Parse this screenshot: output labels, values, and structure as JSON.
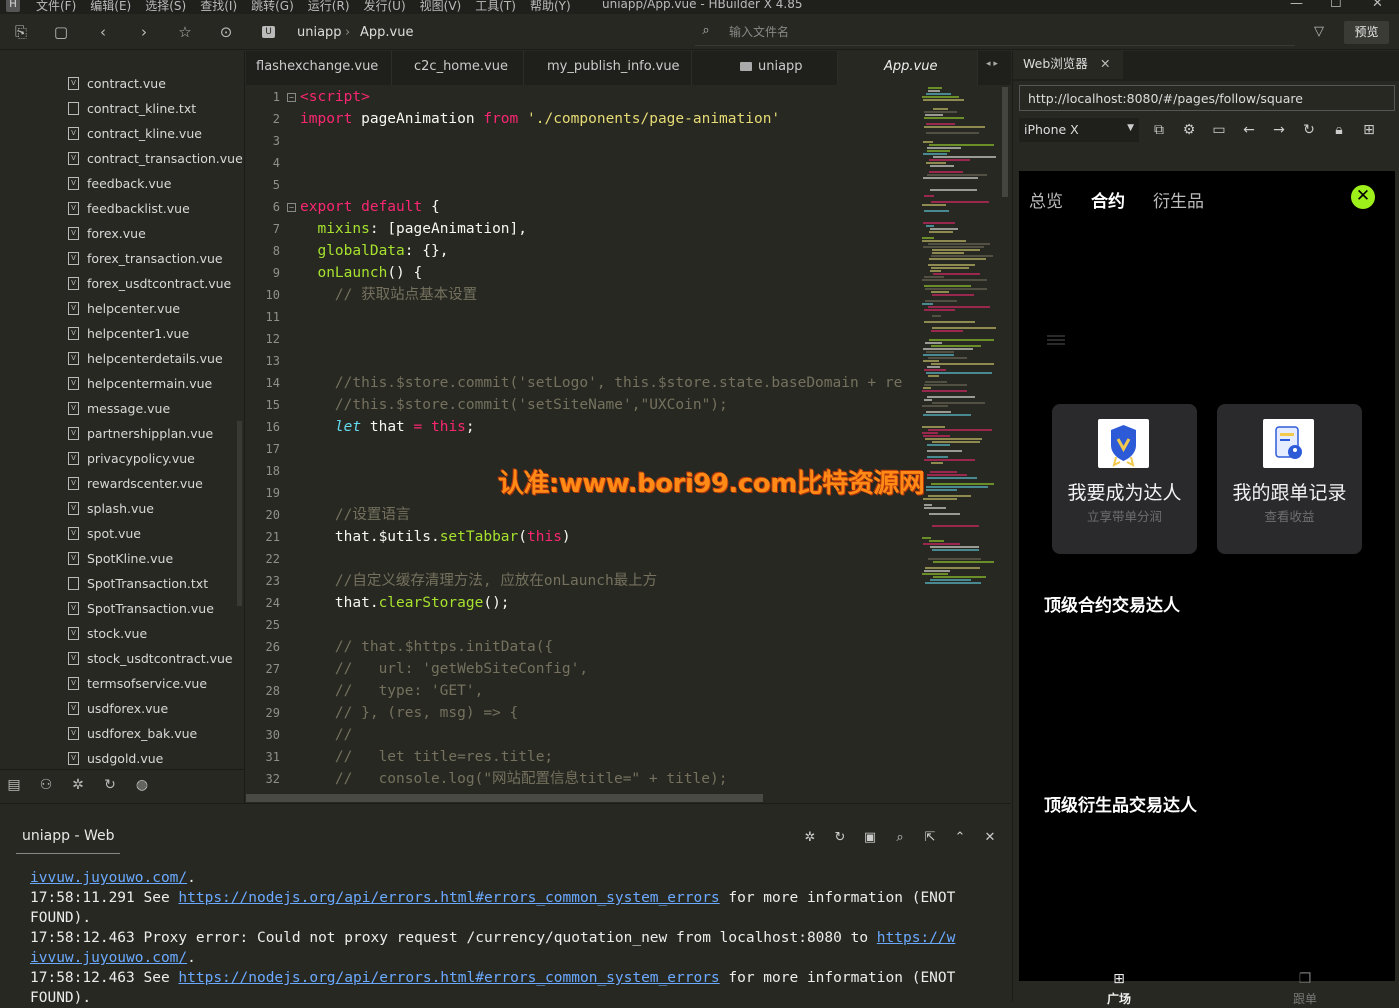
{
  "app": {
    "title": "uniapp/App.vue - HBuilder X 4.85",
    "logo": "H",
    "menus": [
      "文件(F)",
      "编辑(E)",
      "选择(S)",
      "查找(I)",
      "跳转(G)",
      "运行(R)",
      "发行(U)",
      "视图(V)",
      "工具(T)",
      "帮助(Y)"
    ],
    "window_controls": [
      "—",
      "☐",
      "✕"
    ]
  },
  "toolbar": {
    "breadcrumb": [
      "uniapp",
      "App.vue"
    ],
    "breadcrumb_sep": "›",
    "search_placeholder": "输入文件名",
    "preview_label": "预览",
    "icons": [
      "save-all-icon",
      "save-icon",
      "back-icon",
      "forward-icon",
      "star-icon",
      "run-icon",
      "filter-icon"
    ]
  },
  "sidebar": {
    "files": [
      {
        "name": "contract.vue",
        "type": "vue"
      },
      {
        "name": "contract_kline.txt",
        "type": "txt"
      },
      {
        "name": "contract_kline.vue",
        "type": "vue"
      },
      {
        "name": "contract_transaction.vue",
        "type": "vue"
      },
      {
        "name": "feedback.vue",
        "type": "vue"
      },
      {
        "name": "feedbacklist.vue",
        "type": "vue"
      },
      {
        "name": "forex.vue",
        "type": "vue"
      },
      {
        "name": "forex_transaction.vue",
        "type": "vue"
      },
      {
        "name": "forex_usdtcontract.vue",
        "type": "vue"
      },
      {
        "name": "helpcenter.vue",
        "type": "vue"
      },
      {
        "name": "helpcenter1.vue",
        "type": "vue"
      },
      {
        "name": "helpcenterdetails.vue",
        "type": "vue"
      },
      {
        "name": "helpcentermain.vue",
        "type": "vue"
      },
      {
        "name": "message.vue",
        "type": "vue"
      },
      {
        "name": "partnershipplan.vue",
        "type": "vue"
      },
      {
        "name": "privacypolicy.vue",
        "type": "vue"
      },
      {
        "name": "rewardscenter.vue",
        "type": "vue"
      },
      {
        "name": "splash.vue",
        "type": "vue"
      },
      {
        "name": "spot.vue",
        "type": "vue"
      },
      {
        "name": "SpotKline.vue",
        "type": "vue"
      },
      {
        "name": "SpotTransaction.txt",
        "type": "txt"
      },
      {
        "name": "SpotTransaction.vue",
        "type": "vue"
      },
      {
        "name": "stock.vue",
        "type": "vue"
      },
      {
        "name": "stock_usdtcontract.vue",
        "type": "vue"
      },
      {
        "name": "termsofservice.vue",
        "type": "vue"
      },
      {
        "name": "usdforex.vue",
        "type": "vue"
      },
      {
        "name": "usdforex_bak.vue",
        "type": "vue"
      },
      {
        "name": "usdgold.vue",
        "type": "vue"
      }
    ],
    "bottom_tabs": [
      "project-explorer-icon",
      "plugin-icon",
      "debug-icon",
      "git-icon",
      "web-icon"
    ]
  },
  "tabs": [
    {
      "label": "flashexchange.vue",
      "active": false
    },
    {
      "label": "c2c_home.vue",
      "active": false
    },
    {
      "label": "my_publish_info.vue",
      "active": false
    },
    {
      "label": "uniapp",
      "active": false,
      "folder": true
    },
    {
      "label": "App.vue",
      "active": true
    }
  ],
  "tab_scroll": "◂ ▸",
  "editor": {
    "lines": [
      {
        "n": "1",
        "fold": true,
        "html": "<span class='tag'>&lt;script&gt;</span>"
      },
      {
        "n": "2",
        "html": "<span class='kw'>import</span> pageAnimation <span class='kw'>from</span> <span class='str'>'./components/page-animation'</span>"
      },
      {
        "n": "3",
        "html": ""
      },
      {
        "n": "4",
        "html": ""
      },
      {
        "n": "5",
        "html": ""
      },
      {
        "n": "6",
        "fold": true,
        "html": "<span class='kw'>export default</span> {"
      },
      {
        "n": "7",
        "html": "  <span class='fn'>mixins</span>: [pageAnimation],"
      },
      {
        "n": "8",
        "html": "  <span class='fn'>globalData</span>: {},"
      },
      {
        "n": "9",
        "html": "  <span class='fn'>onLaunch</span>() {"
      },
      {
        "n": "10",
        "html": "    <span class='cm'>// 获取站点基本设置</span>"
      },
      {
        "n": "11",
        "html": ""
      },
      {
        "n": "12",
        "html": ""
      },
      {
        "n": "13",
        "html": ""
      },
      {
        "n": "14",
        "html": "    <span class='cm'>//this.$store.commit('setLogo', this.$store.state.baseDomain + re</span>"
      },
      {
        "n": "15",
        "html": "    <span class='cm'>//this.$store.commit('setSiteName',\"UXCoin\");</span>"
      },
      {
        "n": "16",
        "html": "    <span class='it'>let</span> that <span class='kw'>=</span> <span class='kw'>this</span>;"
      },
      {
        "n": "17",
        "html": ""
      },
      {
        "n": "18",
        "html": ""
      },
      {
        "n": "19",
        "html": ""
      },
      {
        "n": "20",
        "html": "    <span class='cm'>//设置语言</span>"
      },
      {
        "n": "21",
        "html": "    that.$utils.<span class='fn'>setTabbar</span>(<span class='kw'>this</span>)"
      },
      {
        "n": "22",
        "html": ""
      },
      {
        "n": "23",
        "html": "    <span class='cm'>//自定义缓存清理方法, 应放在onLaunch最上方</span>"
      },
      {
        "n": "24",
        "html": "    that.<span class='fn'>clearStorage</span>();"
      },
      {
        "n": "25",
        "html": ""
      },
      {
        "n": "26",
        "html": "    <span class='cm'>// that.$https.initData({</span>"
      },
      {
        "n": "27",
        "html": "    <span class='cm'>//   url: 'getWebSiteConfig',</span>"
      },
      {
        "n": "28",
        "html": "    <span class='cm'>//   type: 'GET',</span>"
      },
      {
        "n": "29",
        "html": "    <span class='cm'>// }, (res, msg) =&gt; {</span>"
      },
      {
        "n": "30",
        "html": "    <span class='cm'>//</span>"
      },
      {
        "n": "31",
        "html": "    <span class='cm'>//   let title=res.title;</span>"
      },
      {
        "n": "32",
        "html": "    <span class='cm'>//   console.log(\"网站配置信息title=\" + title);</span>"
      }
    ]
  },
  "watermark": "认准:www.bori99.com比特资源网",
  "browser": {
    "tab_label": "Web浏览器",
    "tab_close": "✕",
    "url": "http://localhost:8080/#/pages/follow/square",
    "device": "iPhone X",
    "device_icons": [
      "screenshot-icon",
      "settings-icon",
      "console-icon",
      "back-icon",
      "forward-icon",
      "refresh-icon",
      "lock-icon",
      "grid-icon"
    ]
  },
  "phone": {
    "tabs": [
      {
        "label": "总览",
        "active": false
      },
      {
        "label": "合约",
        "active": true
      },
      {
        "label": "衍生品",
        "active": false
      }
    ],
    "close": "✕",
    "cards": [
      {
        "title": "我要成为达人",
        "subtitle": "立享带单分润",
        "icon": "badge-v-icon"
      },
      {
        "title": "我的跟单记录",
        "subtitle": "查看收益",
        "icon": "document-user-icon"
      }
    ],
    "sections": [
      "顶级合约交易达人",
      "顶级衍生品交易达人"
    ],
    "nav": [
      {
        "label": "广场",
        "icon": "grid-icon",
        "active": true
      },
      {
        "label": "跟单",
        "icon": "copy-icon",
        "active": false
      }
    ]
  },
  "console": {
    "tab_label": "uniapp - Web",
    "icons": [
      "debug-icon",
      "restart-icon",
      "stop-icon",
      "search-log-icon",
      "export-icon",
      "collapse-icon",
      "clear-icon"
    ],
    "lines": [
      {
        "parts": [
          {
            "link": "ivvuw.juyouwo.com/"
          },
          {
            "text": "."
          }
        ]
      },
      {
        "parts": [
          {
            "text": "17:58:11.291 See "
          },
          {
            "link": "https://nodejs.org/api/errors.html#errors_common_system_errors"
          },
          {
            "text": " for more information (ENOT"
          }
        ]
      },
      {
        "parts": [
          {
            "text": "FOUND)."
          }
        ]
      },
      {
        "parts": [
          {
            "text": "17:58:12.463 Proxy error: Could not proxy request /currency/quotation_new from localhost:8080 to "
          },
          {
            "link": "https://w"
          }
        ]
      },
      {
        "parts": [
          {
            "link": "ivvuw.juyouwo.com/"
          },
          {
            "text": "."
          }
        ]
      },
      {
        "parts": [
          {
            "text": "17:58:12.463 See "
          },
          {
            "link": "https://nodejs.org/api/errors.html#errors_common_system_errors"
          },
          {
            "text": " for more information (ENOT"
          }
        ]
      },
      {
        "parts": [
          {
            "text": "FOUND)."
          }
        ]
      }
    ]
  },
  "colors": {
    "editor_bg": "#272822",
    "accent_green": "#9ef01a",
    "link": "#6aa9ff",
    "watermark": "#ff8a16"
  }
}
